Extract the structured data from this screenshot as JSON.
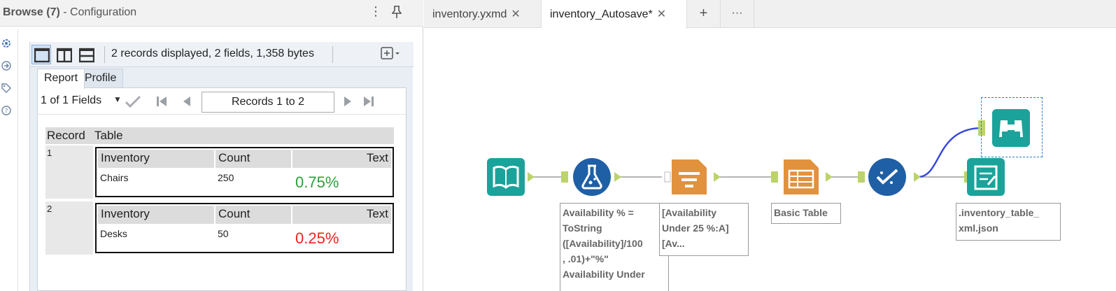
{
  "panel": {
    "title_strong": "Browse (7)",
    "title_rest": " - Configuration",
    "more_icon": "⋮",
    "pin_icon": "pin-icon"
  },
  "side_icons": [
    "gear-icon",
    "connection-icon",
    "tag-icon",
    "help-icon"
  ],
  "toolbar": {
    "summary": "2 records displayed, 2 fields, 1,358 bytes"
  },
  "tabs": [
    "Report",
    "Profile"
  ],
  "nav": {
    "fields_label": "1 of 1 Fields",
    "records_label": "Records 1 to 2"
  },
  "grid": {
    "headers": [
      "Record",
      "Table"
    ],
    "inner_headers": [
      "Inventory",
      "Count",
      "Text"
    ],
    "rows": [
      {
        "num": "1",
        "inventory": "Chairs",
        "count": "250",
        "text": "0.75%",
        "color": "#2e9e3a"
      },
      {
        "num": "2",
        "inventory": "Desks",
        "count": "50",
        "text": "0.25%",
        "color": "#ee2222"
      }
    ]
  },
  "doc_tabs": [
    {
      "label": "inventory.yxmd",
      "close": "✕"
    },
    {
      "label": "inventory_Autosave*",
      "close": "✕"
    }
  ],
  "doc_buttons": {
    "add": "+",
    "more": "···"
  },
  "annotations": {
    "formula": "Availability % =\nToString\n([Availability]/100\n, .01)+\"%\"\nAvailability Under",
    "filter": "[Availability\nUnder 25 %:A]\n[Av...",
    "table": "Basic Table",
    "output": ".inventory_table_\nxml.json"
  },
  "colors": {
    "input_tool": "#1aa39a",
    "formula_tool": "#1f5fa5",
    "filter_tool": "#e2923c",
    "table_tool": "#e2923c",
    "test_tool": "#1f5fa5",
    "output_tool": "#1aa39a",
    "connector": "#bcd36a",
    "selected_wire": "#3344dd"
  }
}
